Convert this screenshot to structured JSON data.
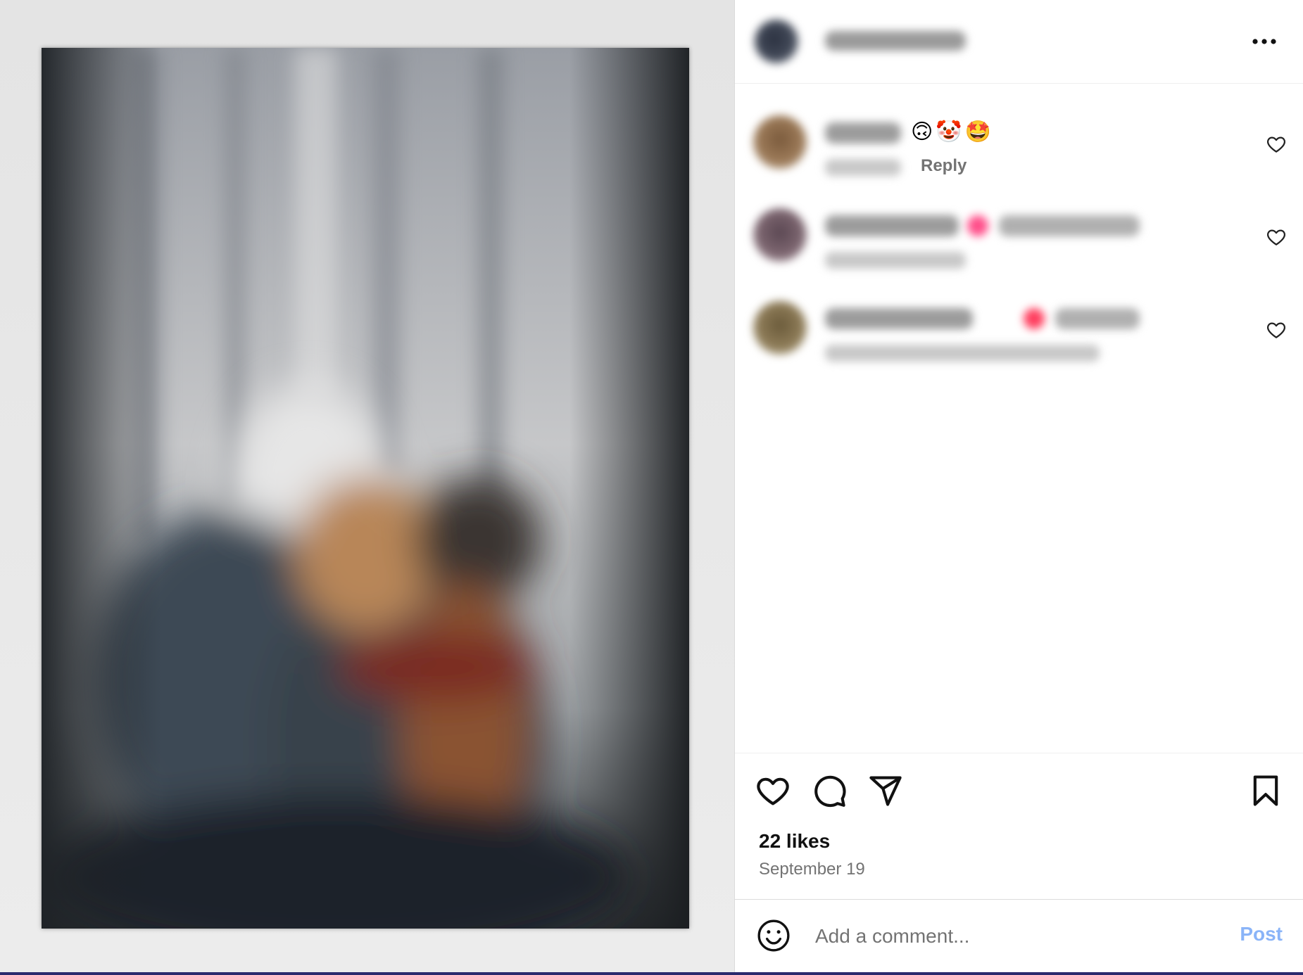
{
  "post": {
    "likes_text": "22 likes",
    "date_text": "September 19"
  },
  "comments": [
    {
      "emojis": "🙃🤡🤩",
      "reply_label": "Reply"
    },
    {
      "emojis": ""
    },
    {
      "emojis": ""
    }
  ],
  "composer": {
    "placeholder": "Add a comment...",
    "post_label": "Post"
  },
  "colors": {
    "post_button": "#8ab4f8",
    "muted_text": "#737373",
    "accent_pink": "#ff4f8a"
  },
  "icons": {
    "header": "more-options-icon",
    "comment_like": "heart-outline-icon",
    "actions": [
      "like-icon",
      "comment-icon",
      "share-icon",
      "save-icon"
    ],
    "composer": "emoji-smiley-icon"
  }
}
